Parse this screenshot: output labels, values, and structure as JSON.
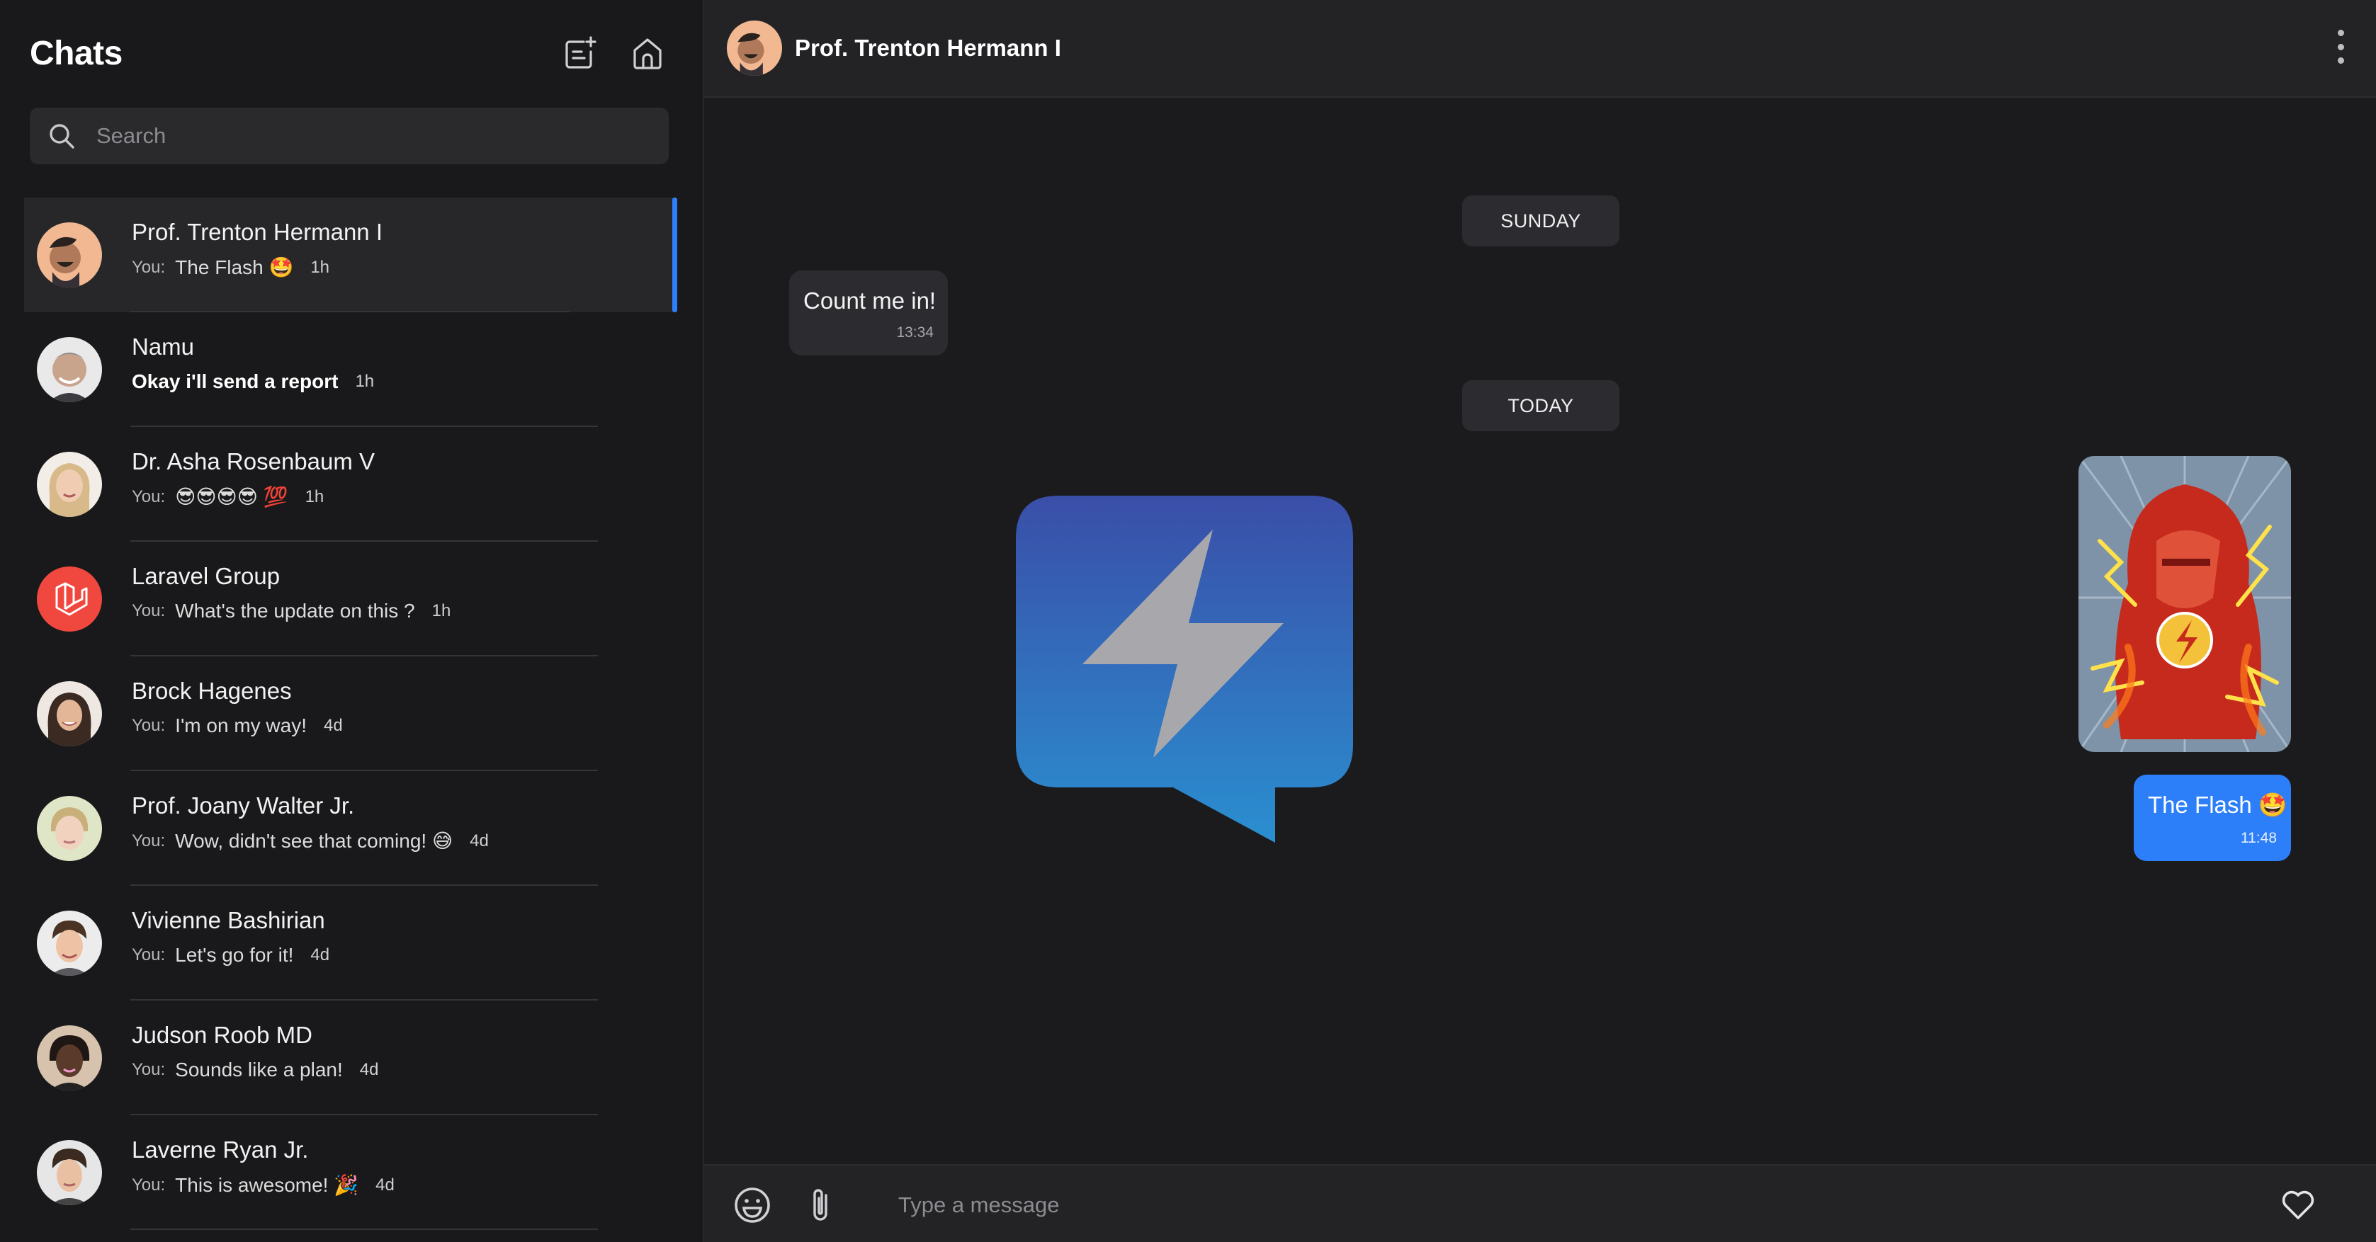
{
  "sidebar": {
    "title": "Chats",
    "search_placeholder": "Search",
    "chats": [
      {
        "name": "Prof. Trenton Hermann I",
        "you": "You:",
        "message": "The Flash 🤩",
        "time": "1h",
        "active": true
      },
      {
        "name": "Namu",
        "you": "",
        "message": "Okay i'll send a report",
        "time": "1h",
        "unread": true
      },
      {
        "name": "Dr. Asha Rosenbaum V",
        "you": "You:",
        "message": "😎😎😎😎 💯",
        "time": "1h"
      },
      {
        "name": "Laravel Group",
        "you": "You:",
        "message": "What's the update on this ?",
        "time": "1h"
      },
      {
        "name": "Brock Hagenes",
        "you": "You:",
        "message": "I'm on my way!",
        "time": "4d"
      },
      {
        "name": "Prof. Joany Walter Jr.",
        "you": "You:",
        "message": "Wow, didn't see that coming! 😅",
        "time": "4d"
      },
      {
        "name": "Vivienne Bashirian",
        "you": "You:",
        "message": "Let's go for it!",
        "time": "4d"
      },
      {
        "name": "Judson Roob MD",
        "you": "You:",
        "message": "Sounds like a plan!",
        "time": "4d"
      },
      {
        "name": "Laverne Ryan Jr.",
        "you": "You:",
        "message": "This is awesome! 🎉",
        "time": "4d"
      }
    ]
  },
  "conversation": {
    "contact_name": "Prof. Trenton Hermann I",
    "day_sunday": "SUNDAY",
    "day_today": "TODAY",
    "incoming": {
      "text": "Count me in!",
      "time": "13:34"
    },
    "outgoing": {
      "text": "The Flash 🤩",
      "time": "11:48"
    },
    "composer_placeholder": "Type a message"
  },
  "colors": {
    "accent": "#2d7ff9",
    "sidebar_bg": "#19191b",
    "main_bg": "#1b1b1d",
    "logo_top": "#3a4ea8",
    "logo_bottom": "#2a8fd0"
  },
  "icons": [
    "new-chat-icon",
    "home-icon",
    "search-icon",
    "kebab-menu-icon",
    "emoji-icon",
    "attachment-icon",
    "heart-icon",
    "app-logo-icon"
  ]
}
